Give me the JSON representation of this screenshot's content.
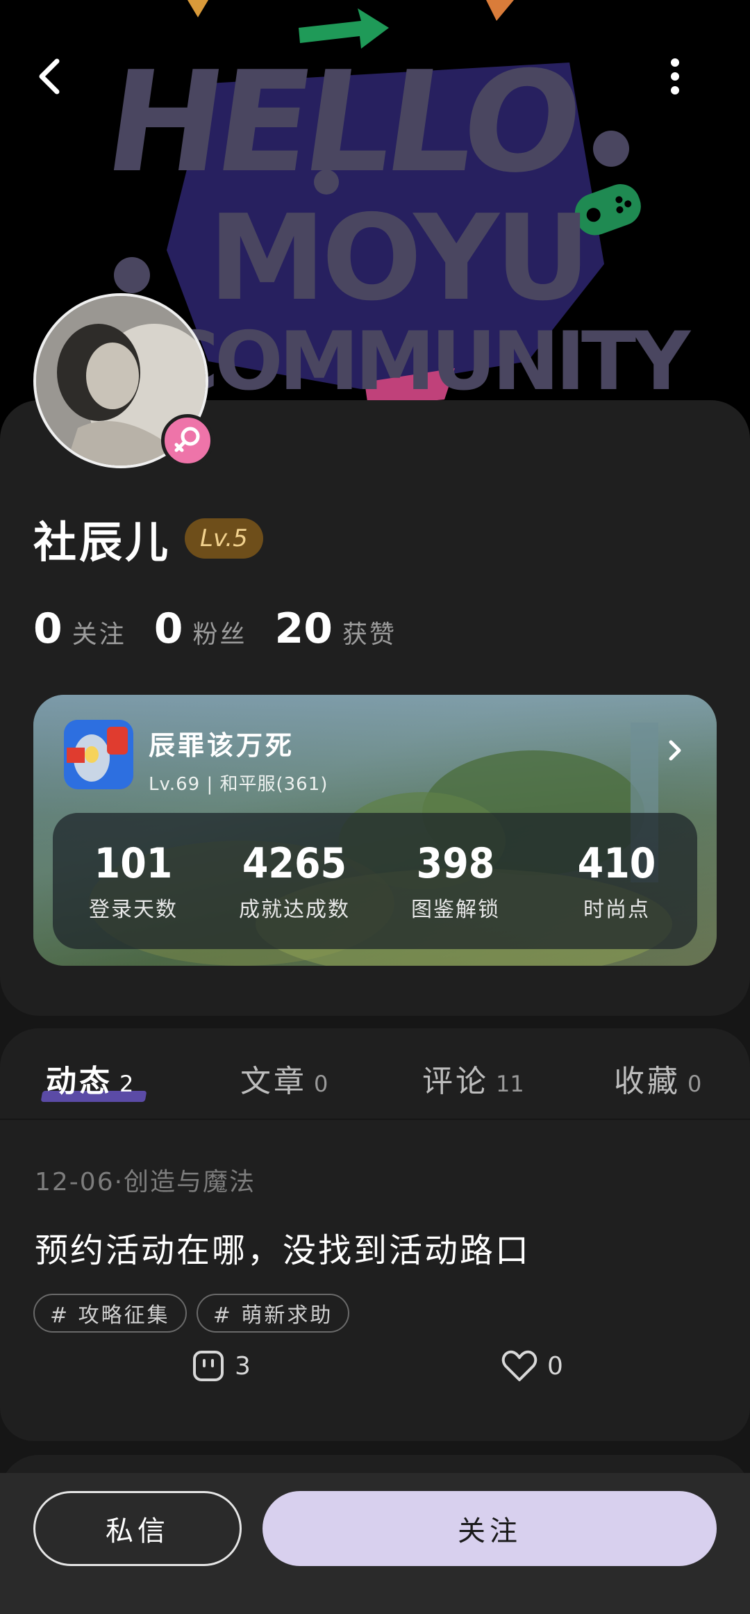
{
  "hero": {
    "banner_text": [
      "HELLO",
      "MOYU",
      "COMMUNITY"
    ],
    "back_icon": "chevron-left-icon",
    "more_icon": "more-vertical-icon"
  },
  "profile": {
    "name": "社辰儿",
    "level": "Lv.5",
    "gender": "female",
    "stats": [
      {
        "value": "0",
        "label": "关注"
      },
      {
        "value": "0",
        "label": "粉丝"
      },
      {
        "value": "20",
        "label": "获赞"
      }
    ]
  },
  "game_card": {
    "role_name": "辰罪该万死",
    "role_sub": "Lv.69 | 和平服(361)",
    "stats": [
      {
        "value": "101",
        "label": "登录天数"
      },
      {
        "value": "4265",
        "label": "成就达成数"
      },
      {
        "value": "398",
        "label": "图鉴解锁"
      },
      {
        "value": "410",
        "label": "时尚点"
      }
    ]
  },
  "tabs": [
    {
      "label": "动态",
      "count": "2",
      "active": true
    },
    {
      "label": "文章",
      "count": "0",
      "active": false
    },
    {
      "label": "评论",
      "count": "11",
      "active": false
    },
    {
      "label": "收藏",
      "count": "0",
      "active": false
    }
  ],
  "post": {
    "meta": "12-06·创造与魔法",
    "title": "预约活动在哪，没找到活动路口",
    "tags": [
      "# 攻略征集",
      "# 萌新求助"
    ],
    "comments": "3",
    "likes": "0"
  },
  "bottom_bar": {
    "message_label": "私信",
    "follow_label": "关注"
  },
  "colors": {
    "accent": "#d8d0ee",
    "level_badge": "#6e4e1a",
    "gender_badge": "#ee74a9",
    "tab_underline": "#5b4ba6"
  }
}
